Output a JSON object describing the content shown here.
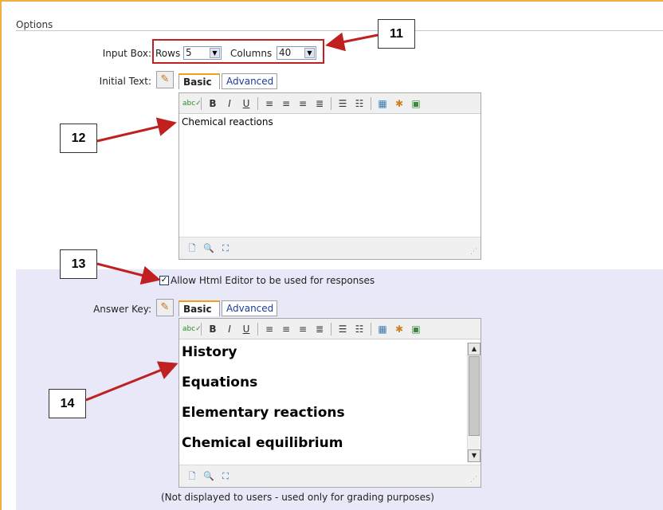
{
  "section": {
    "title": "Options"
  },
  "input_box": {
    "label": "Input Box:",
    "rows_label": "Rows",
    "rows_value": "5",
    "columns_label": "Columns",
    "columns_value": "40"
  },
  "initial_text": {
    "label": "Initial Text:",
    "tab_basic": "Basic",
    "tab_advanced": "Advanced",
    "content": "Chemical reactions"
  },
  "toolbar": {
    "spell": "abc",
    "bold": "B",
    "italic": "I",
    "underline": "U"
  },
  "allow_html": {
    "checked": true,
    "label": "Allow Html Editor to be used for responses"
  },
  "answer_key": {
    "label": "Answer Key:",
    "tab_basic": "Basic",
    "tab_advanced": "Advanced",
    "lines": [
      "History",
      "Equations",
      "Elementary reactions",
      "Chemical equilibrium"
    ],
    "note": "(Not displayed to users - used only for grading purposes)"
  },
  "callouts": [
    "11",
    "12",
    "13",
    "14"
  ],
  "colors": {
    "accent": "#f0a020",
    "callout_arrow": "#c02020",
    "highlight": "#e8e8f8"
  }
}
